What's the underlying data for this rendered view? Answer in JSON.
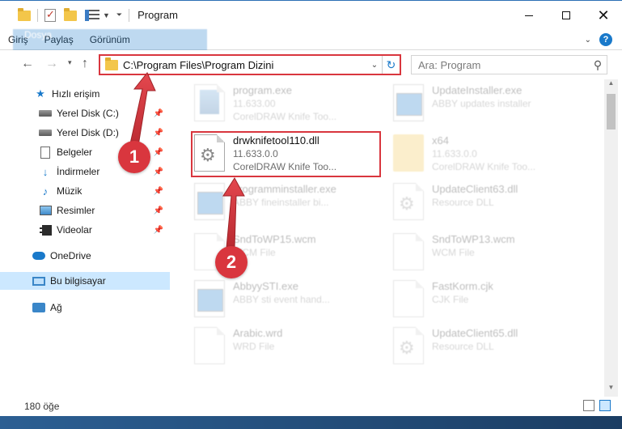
{
  "window": {
    "title": "Program",
    "minimize_label": "",
    "maximize_label": "",
    "close_label": "✕"
  },
  "ribbon": {
    "tabs": [
      "Dosya",
      "Giriş",
      "Paylaş",
      "Görünüm"
    ]
  },
  "address": {
    "path": "C:\\Program Files\\Program Dizini",
    "search_placeholder": "Ara: Program"
  },
  "sidebar": {
    "items": [
      {
        "label": "Hızlı erişim",
        "icon": "star-icon"
      },
      {
        "label": "Yerel Disk (C:)",
        "icon": "drive-icon",
        "pinned": true
      },
      {
        "label": "Yerel Disk (D:)",
        "icon": "drive-icon",
        "pinned": true
      },
      {
        "label": "Belgeler",
        "icon": "documents-icon",
        "pinned": true
      },
      {
        "label": "İndirmeler",
        "icon": "downloads-icon",
        "pinned": true
      },
      {
        "label": "Müzik",
        "icon": "music-icon",
        "pinned": true
      },
      {
        "label": "Resimler",
        "icon": "pictures-icon",
        "pinned": true
      },
      {
        "label": "Videolar",
        "icon": "videos-icon",
        "pinned": true
      },
      {
        "label": "OneDrive",
        "icon": "onedrive-icon"
      },
      {
        "label": "Bu bilgisayar",
        "icon": "this-pc-icon",
        "selected": true
      },
      {
        "label": "Ağ",
        "icon": "network-icon"
      }
    ]
  },
  "files": [
    {
      "name": "program.exe",
      "meta1": "11.633.00",
      "meta2": "CorelDRAW Knife Too...",
      "icon": "exe"
    },
    {
      "name": "UpdateInstaller.exe",
      "meta1": "ABBY updates installer",
      "meta2": "",
      "icon": "app"
    },
    {
      "name": "drwknifetool110.dll",
      "meta1": "11.633.0.0",
      "meta2": "CorelDRAW Knife Too...",
      "icon": "gear",
      "focus": true
    },
    {
      "name": "x64",
      "meta1": "11.633.0.0",
      "meta2": "CorelDRAW Knife Too...",
      "icon": "folder"
    },
    {
      "name": "programminstaller.exe",
      "meta1": "ABBY fineinstaller bi...",
      "meta2": "",
      "icon": "app"
    },
    {
      "name": "UpdateClient63.dll",
      "meta1": "Resource DLL",
      "meta2": "",
      "icon": "gear"
    },
    {
      "name": "SndToWP15.wcm",
      "meta1": "WCM File",
      "meta2": "",
      "icon": "doc"
    },
    {
      "name": "SndToWP13.wcm",
      "meta1": "WCM File",
      "meta2": "",
      "icon": "doc"
    },
    {
      "name": "AbbyySTI.exe",
      "meta1": "ABBY sti event hand...",
      "meta2": "",
      "icon": "app"
    },
    {
      "name": "FastKorm.cjk",
      "meta1": "CJK File",
      "meta2": "",
      "icon": "doc"
    },
    {
      "name": "Arabic.wrd",
      "meta1": "WRD File",
      "meta2": "",
      "icon": "doc"
    },
    {
      "name": "UpdateClient65.dll",
      "meta1": "Resource DLL",
      "meta2": "",
      "icon": "gear"
    }
  ],
  "status": {
    "count": "180 öğe"
  },
  "annotations": {
    "badge1": "1",
    "badge2": "2"
  },
  "colors": {
    "accent": "#1979ca",
    "highlight": "#d9363e",
    "selected": "#cce8ff"
  }
}
